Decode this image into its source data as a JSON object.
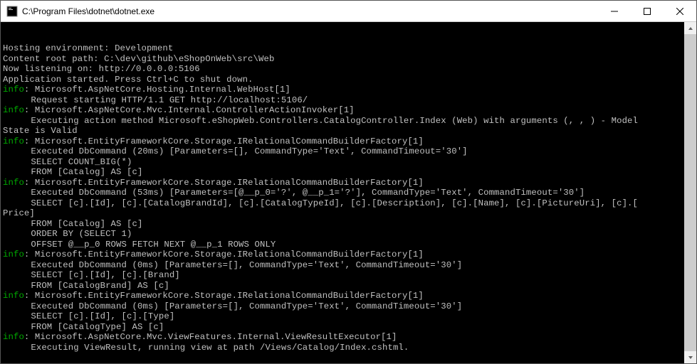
{
  "window": {
    "title": "C:\\Program Files\\dotnet\\dotnet.exe"
  },
  "lines": [
    {
      "type": "plain",
      "text": "Hosting environment: Development"
    },
    {
      "type": "plain",
      "text": "Content root path: C:\\dev\\github\\eShopOnWeb\\src\\Web"
    },
    {
      "type": "plain",
      "text": "Now listening on: http://0.0.0.0:5106"
    },
    {
      "type": "plain",
      "text": "Application started. Press Ctrl+C to shut down."
    },
    {
      "type": "info",
      "prefix": "info",
      "sep": ": ",
      "text": "Microsoft.AspNetCore.Hosting.Internal.WebHost[1]"
    },
    {
      "type": "indent",
      "text": "Request starting HTTP/1.1 GET http://localhost:5106/"
    },
    {
      "type": "info",
      "prefix": "info",
      "sep": ": ",
      "text": "Microsoft.AspNetCore.Mvc.Internal.ControllerActionInvoker[1]"
    },
    {
      "type": "indent",
      "text": "Executing action method Microsoft.eShopWeb.Controllers.CatalogController.Index (Web) with arguments (, , ) - Model"
    },
    {
      "type": "plain",
      "text": "State is Valid"
    },
    {
      "type": "info",
      "prefix": "info",
      "sep": ": ",
      "text": "Microsoft.EntityFrameworkCore.Storage.IRelationalCommandBuilderFactory[1]"
    },
    {
      "type": "indent",
      "text": "Executed DbCommand (20ms) [Parameters=[], CommandType='Text', CommandTimeout='30']"
    },
    {
      "type": "indent",
      "text": "SELECT COUNT_BIG(*)"
    },
    {
      "type": "indent",
      "text": "FROM [Catalog] AS [c]"
    },
    {
      "type": "info",
      "prefix": "info",
      "sep": ": ",
      "text": "Microsoft.EntityFrameworkCore.Storage.IRelationalCommandBuilderFactory[1]"
    },
    {
      "type": "indent",
      "text": "Executed DbCommand (53ms) [Parameters=[@__p_0='?', @__p_1='?'], CommandType='Text', CommandTimeout='30']"
    },
    {
      "type": "indent",
      "text": "SELECT [c].[Id], [c].[CatalogBrandId], [c].[CatalogTypeId], [c].[Description], [c].[Name], [c].[PictureUri], [c].["
    },
    {
      "type": "plain",
      "text": "Price]"
    },
    {
      "type": "indent",
      "text": "FROM [Catalog] AS [c]"
    },
    {
      "type": "indent",
      "text": "ORDER BY (SELECT 1)"
    },
    {
      "type": "indent",
      "text": "OFFSET @__p_0 ROWS FETCH NEXT @__p_1 ROWS ONLY"
    },
    {
      "type": "info",
      "prefix": "info",
      "sep": ": ",
      "text": "Microsoft.EntityFrameworkCore.Storage.IRelationalCommandBuilderFactory[1]"
    },
    {
      "type": "indent",
      "text": "Executed DbCommand (0ms) [Parameters=[], CommandType='Text', CommandTimeout='30']"
    },
    {
      "type": "indent",
      "text": "SELECT [c].[Id], [c].[Brand]"
    },
    {
      "type": "indent",
      "text": "FROM [CatalogBrand] AS [c]"
    },
    {
      "type": "info",
      "prefix": "info",
      "sep": ": ",
      "text": "Microsoft.EntityFrameworkCore.Storage.IRelationalCommandBuilderFactory[1]"
    },
    {
      "type": "indent",
      "text": "Executed DbCommand (0ms) [Parameters=[], CommandType='Text', CommandTimeout='30']"
    },
    {
      "type": "indent",
      "text": "SELECT [c].[Id], [c].[Type]"
    },
    {
      "type": "indent",
      "text": "FROM [CatalogType] AS [c]"
    },
    {
      "type": "info",
      "prefix": "info",
      "sep": ": ",
      "text": "Microsoft.AspNetCore.Mvc.ViewFeatures.Internal.ViewResultExecutor[1]"
    },
    {
      "type": "indent",
      "text": "Executing ViewResult, running view at path /Views/Catalog/Index.cshtml."
    }
  ]
}
